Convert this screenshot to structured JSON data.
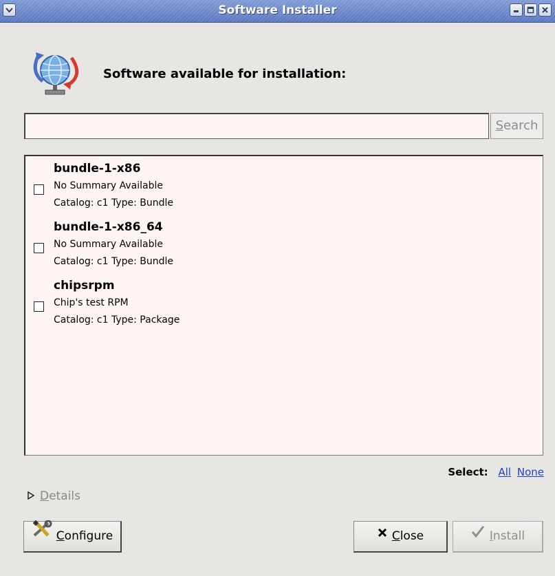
{
  "window": {
    "title": "Software Installer",
    "menu_icon": "chevron-down-icon",
    "controls": [
      "minimize-icon",
      "maximize-icon",
      "close-icon"
    ]
  },
  "header": {
    "icon": "globe-network-icon",
    "text": "Software available for installation:"
  },
  "search": {
    "value": "",
    "placeholder": "",
    "button_label_mnemonic": "S",
    "button_label_rest": "earch"
  },
  "items": [
    {
      "name": "bundle-1-x86",
      "summary": "No Summary Available",
      "catalog": "Catalog: c1 Type: Bundle",
      "checked": false
    },
    {
      "name": "bundle-1-x86_64",
      "summary": "No Summary Available",
      "catalog": "Catalog: c1 Type: Bundle",
      "checked": false
    },
    {
      "name": "chipsrpm",
      "summary": "Chip's test RPM",
      "catalog": "Catalog: c1 Type: Package",
      "checked": false
    }
  ],
  "select": {
    "label": "Select:",
    "all": "All",
    "none": "None"
  },
  "details": {
    "label_mnemonic": "D",
    "label_rest": "etails",
    "icon": "triangle-right-icon"
  },
  "buttons": {
    "configure_mnemonic": "C",
    "configure_rest": "onfigure",
    "configure_icon": "tools-icon",
    "close_mnemonic": "C",
    "close_rest": "lose",
    "close_icon": "x-icon",
    "install_mnemonic": "I",
    "install_rest": "nstall",
    "install_icon": "checkmark-icon"
  },
  "colors": {
    "titlebar": "#6f89cb",
    "list_background": "#fff5f5",
    "link": "#1b3fd1",
    "disabled_text": "#8e8e8e"
  }
}
